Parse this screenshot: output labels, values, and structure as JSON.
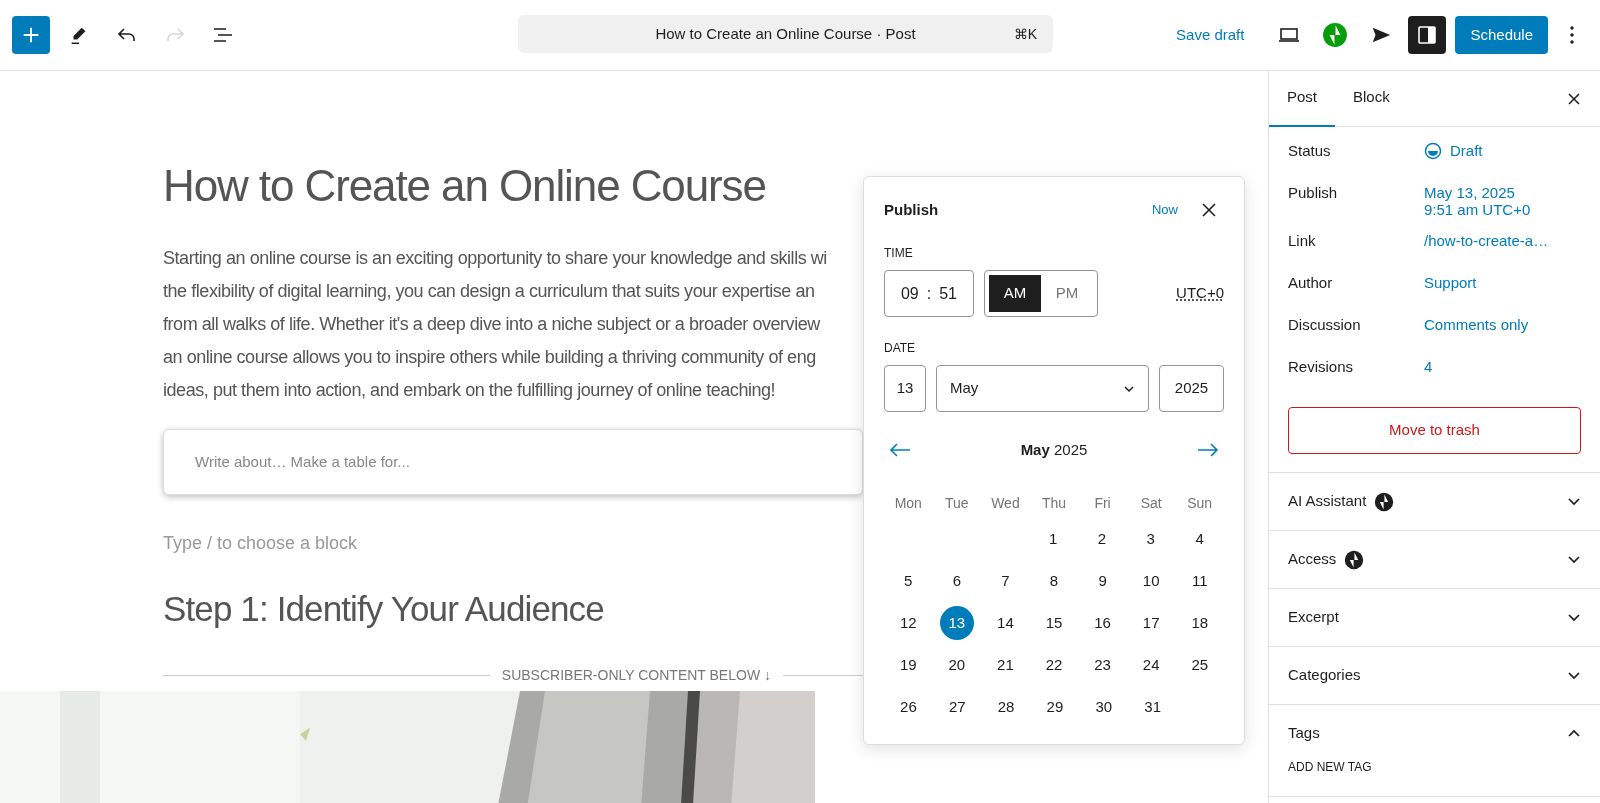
{
  "toolbar": {
    "left": [
      {
        "kind": "add",
        "disabled": false
      },
      {
        "kind": "edit",
        "disabled": false
      },
      {
        "kind": "undo",
        "disabled": false
      },
      {
        "kind": "redo",
        "disabled": true
      },
      {
        "kind": "list",
        "disabled": false
      }
    ],
    "command": {
      "title": "How to Create an Online Course · Post",
      "shortcut": "⌘K"
    },
    "save": "Save draft",
    "right": [
      {
        "kind": "preview",
        "pressed": false
      },
      {
        "kind": "jetpack",
        "pressed": false
      },
      {
        "kind": "send",
        "pressed": false
      },
      {
        "kind": "sidebar",
        "pressed": true
      }
    ],
    "primary": "Schedule"
  },
  "editor": {
    "title": "How to Create an Online Course",
    "paragraph_lines": [
      "Starting an online course is an exciting opportunity to share your knowledge and skills wi",
      "the flexibility of digital learning, you can design a curriculum that suits your expertise an",
      "from all walks of life. Whether it's a deep dive into a niche subject or a broader overview",
      "an online course allows you to inspire others while building a thriving community of eng",
      "ideas, put them into action, and embark on the fulfilling journey of online teaching!"
    ],
    "ai_prompt": {
      "placeholder": "Write about… Make a table for..."
    },
    "block_hint": "Type / to choose a block",
    "heading": "Step 1: Identify Your Audience",
    "divider": "SUBSCRIBER-ONLY CONTENT BELOW ↓",
    "image": {
      "kind": "picture"
    }
  },
  "publish_popover": {
    "title": "Publish",
    "now": "Now",
    "time_label": "TIME",
    "hour": "09",
    "separator": ":",
    "minute": "51",
    "meridiem": [
      {
        "label": "AM",
        "selected": true
      },
      {
        "label": "PM",
        "selected": false
      }
    ],
    "timezone": "UTC+0",
    "date_label": "DATE",
    "day": "13",
    "month": "May",
    "year": "2025",
    "calendar": {
      "heading": "**May** 2025",
      "weekdays": [
        "Mon",
        "Tue",
        "Wed",
        "Thu",
        "Fri",
        "Sat",
        "Sun"
      ],
      "weeks": [
        {
          "midweek_start": true,
          "days": [
            {
              "day": "1",
              "selected": false
            },
            {
              "day": "2",
              "selected": false
            },
            {
              "day": "3",
              "selected": false
            },
            {
              "day": "4",
              "selected": false
            }
          ]
        },
        {
          "days": [
            {
              "day": "5",
              "selected": false
            },
            {
              "day": "6",
              "selected": false
            },
            {
              "day": "7",
              "selected": false
            },
            {
              "day": "8",
              "selected": false
            },
            {
              "day": "9",
              "selected": false
            },
            {
              "day": "10",
              "selected": false
            },
            {
              "day": "11",
              "selected": false
            }
          ]
        },
        {
          "days": [
            {
              "day": "12",
              "selected": false
            },
            {
              "day": "13",
              "selected": true
            },
            {
              "day": "14",
              "selected": false
            },
            {
              "day": "15",
              "selected": false
            },
            {
              "day": "16",
              "selected": false
            },
            {
              "day": "17",
              "selected": false
            },
            {
              "day": "18",
              "selected": false
            }
          ]
        },
        {
          "days": [
            {
              "day": "19",
              "selected": false
            },
            {
              "day": "20",
              "selected": false
            },
            {
              "day": "21",
              "selected": false
            },
            {
              "day": "22",
              "selected": false
            },
            {
              "day": "23",
              "selected": false
            },
            {
              "day": "24",
              "selected": false
            },
            {
              "day": "25",
              "selected": false
            }
          ]
        },
        {
          "midweek_start": false,
          "days": [
            {
              "day": "26",
              "selected": false
            },
            {
              "day": "27",
              "selected": false
            },
            {
              "day": "28",
              "selected": false
            },
            {
              "day": "29",
              "selected": false
            },
            {
              "day": "30",
              "selected": false
            },
            {
              "day": "31",
              "selected": false
            }
          ]
        }
      ]
    }
  },
  "sidebar": {
    "tabs": [
      {
        "label": "Post",
        "selected": true
      },
      {
        "label": "Block",
        "selected": false
      }
    ],
    "summary": [
      {
        "label": "Status",
        "value": [
          "Draft"
        ],
        "kind": "status"
      },
      {
        "label": "Publish",
        "value": [
          "May 13, 2025",
          "9:51 am UTC+0"
        ],
        "kind": "link"
      },
      {
        "label": "Link",
        "value": [
          "/how-to-create-a…"
        ],
        "kind": "link"
      },
      {
        "label": "Author",
        "value": [
          "Support"
        ],
        "kind": "link"
      },
      {
        "label": "Discussion",
        "value": [
          "Comments only"
        ],
        "kind": "link"
      },
      {
        "label": "Revisions",
        "value": [
          "4"
        ],
        "kind": "link"
      }
    ],
    "trash": "Move to trash",
    "panels": [
      {
        "title": "AI Assistant",
        "badge": true,
        "expanded": false
      },
      {
        "title": "Access",
        "badge": true,
        "expanded": false
      },
      {
        "title": "Excerpt",
        "badge": false,
        "expanded": false
      },
      {
        "title": "Categories",
        "badge": false,
        "expanded": false
      },
      {
        "title": "Tags",
        "badge": false,
        "expanded": true,
        "content": "ADD NEW TAG"
      }
    ]
  }
}
